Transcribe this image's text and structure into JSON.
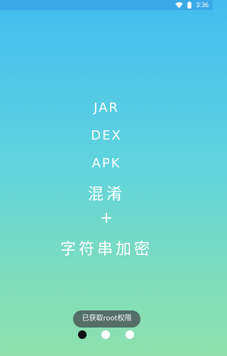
{
  "status_bar": {
    "time": "3:36",
    "icons": [
      "wifi-icon",
      "battery-icon"
    ]
  },
  "feature_lines": [
    "JAR",
    "DEX",
    "APK",
    "混淆",
    "+",
    "字符串加密"
  ],
  "toast": {
    "text": "已获取root权限"
  },
  "pager": {
    "count": 3,
    "active_index": 0
  },
  "colors": {
    "gradient_top": "#43bcef",
    "gradient_bottom": "#8fe0ad",
    "text": "#ffffff",
    "toast_bg": "#464e52",
    "active_dot": "#111111",
    "inactive_dot": "#ffffff"
  }
}
